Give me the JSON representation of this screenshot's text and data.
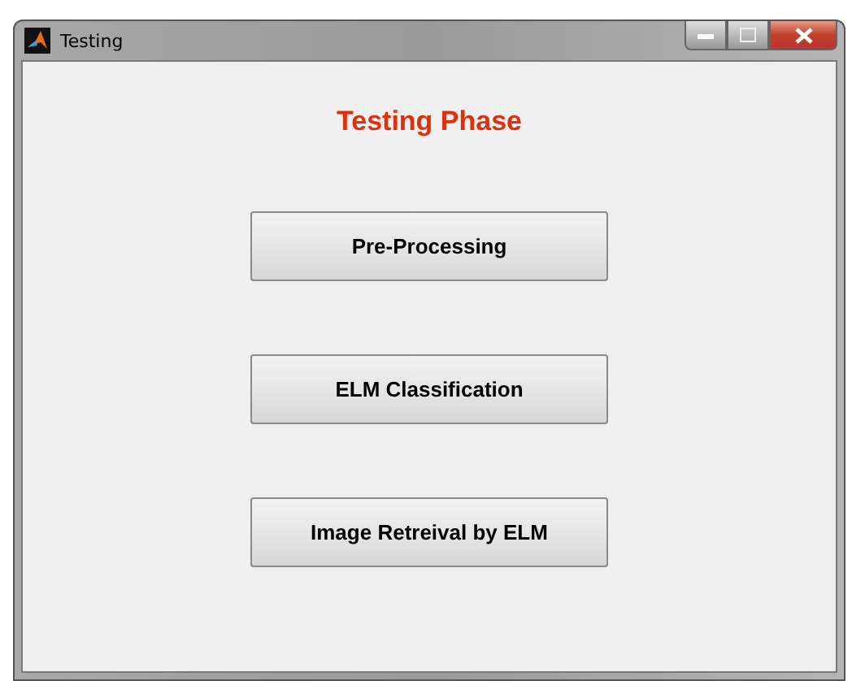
{
  "window": {
    "title": "Testing"
  },
  "heading": "Testing Phase",
  "buttons": [
    {
      "label": "Pre-Processing"
    },
    {
      "label": "ELM Classification"
    },
    {
      "label": "Image Retreival by ELM"
    }
  ]
}
